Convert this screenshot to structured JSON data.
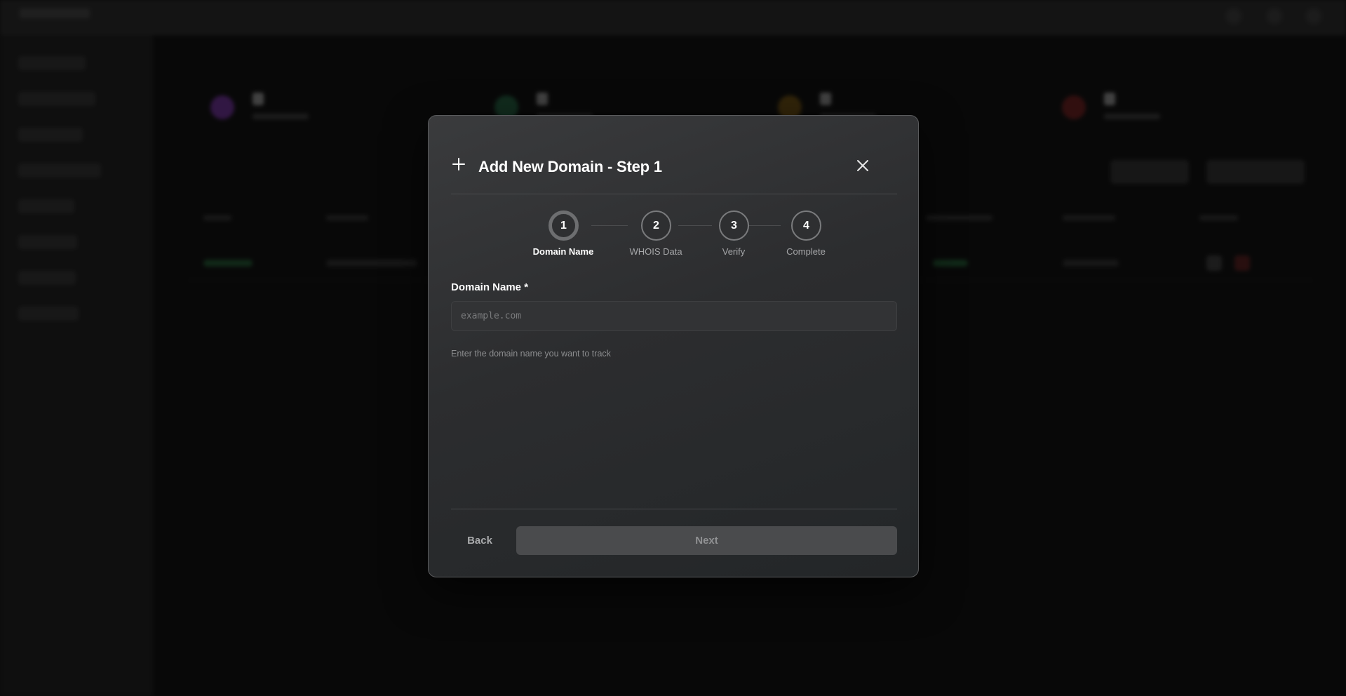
{
  "modal": {
    "title": "Add New Domain - Step 1",
    "steps": [
      {
        "number": "1",
        "label": "Domain Name",
        "active": true
      },
      {
        "number": "2",
        "label": "WHOIS Data",
        "active": false
      },
      {
        "number": "3",
        "label": "Verify",
        "active": false
      },
      {
        "number": "4",
        "label": "Complete",
        "active": false
      }
    ],
    "field": {
      "label": "Domain Name *",
      "placeholder": "example.com",
      "value": "",
      "help": "Enter the domain name you want to track"
    },
    "buttons": {
      "back": "Back",
      "next": "Next"
    }
  },
  "icons": {
    "header_icon": "plus-icon",
    "close_icon": "close-icon"
  },
  "colors": {
    "modal_background": "#2e2f31",
    "overlay": "#000000",
    "text_primary": "#ffffff",
    "text_muted": "#8c8d8f",
    "next_button_disabled": "#4a4b4d"
  }
}
